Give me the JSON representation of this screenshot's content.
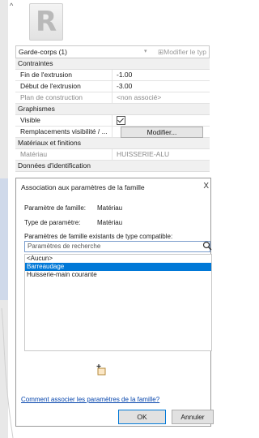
{
  "properties": {
    "type_selector": "Garde-corps (1)",
    "edit_type_label": "Modifier le typ",
    "groups": {
      "constraints": "Contraintes",
      "graphics": "Graphismes",
      "materials": "Matériaux et finitions",
      "identity": "Données d'identification"
    },
    "rows": {
      "end_extrusion": {
        "label": "Fin de l'extrusion",
        "value": "-1.00"
      },
      "start_extrusion": {
        "label": "Début de l'extrusion",
        "value": "-3.00"
      },
      "work_plane": {
        "label": "Plan de construction",
        "value": "<non associé>"
      },
      "visible": {
        "label": "Visible"
      },
      "visibility_overrides": {
        "label": "Remplacements visibilité / ...",
        "button": "Modifier..."
      },
      "material": {
        "label": "Matériau",
        "value": "HUISSERIE-ALU"
      }
    }
  },
  "dialog": {
    "title": "Association aux paramètres de la famille",
    "close": "X",
    "family_param_label": "Paramètre de famille:",
    "family_param_value": "Matériau",
    "param_type_label": "Type de paramètre:",
    "param_type_value": "Matériau",
    "existing_label": "Paramètres de famille existants de type compatible:",
    "search_placeholder": "Paramètres de recherche",
    "list_items": [
      "<Aucun>",
      "Barreaudage",
      "Huisserie-main courante"
    ],
    "selected_index": 1,
    "help_link": "Comment associer les paramètres de la famille?",
    "ok": "OK",
    "cancel": "Annuler"
  },
  "colors": {
    "selection": "#0078d7",
    "link": "#0645ad"
  },
  "icons": [
    "collapse-arrow-icon",
    "revit-logo-icon",
    "checkbox-checked-icon",
    "search-icon",
    "add-parameter-icon"
  ]
}
